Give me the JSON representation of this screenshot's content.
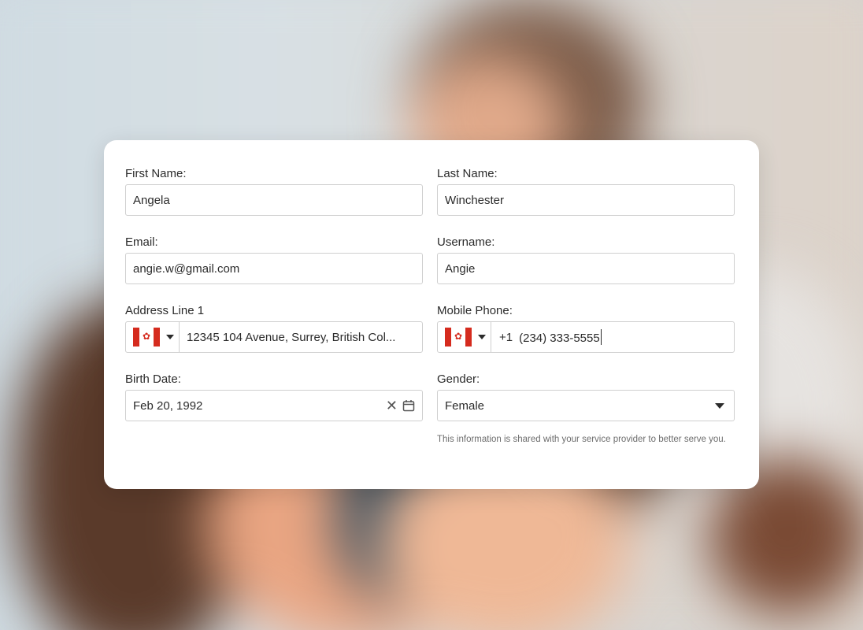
{
  "form": {
    "first_name": {
      "label": "First Name:",
      "value": "Angela"
    },
    "last_name": {
      "label": "Last Name:",
      "value": "Winchester"
    },
    "email": {
      "label": "Email:",
      "value": "angie.w@gmail.com"
    },
    "username": {
      "label": "Username:",
      "value": "Angie"
    },
    "address": {
      "label": "Address Line 1",
      "value": "12345 104 Avenue, Surrey, British Col...",
      "country_icon": "canada-flag-icon"
    },
    "mobile_phone": {
      "label": "Mobile Phone:",
      "prefix": "+1",
      "value": "(234) 333-5555",
      "country_icon": "canada-flag-icon"
    },
    "birth_date": {
      "label": "Birth Date:",
      "value": "Feb 20, 1992"
    },
    "gender": {
      "label": "Gender:",
      "value": "Female",
      "help_text": "This information is shared with your service provider to better serve you."
    }
  },
  "colors": {
    "flag_red": "#d52b1e",
    "border": "#cfcfcf",
    "text": "#2b2b2b"
  }
}
